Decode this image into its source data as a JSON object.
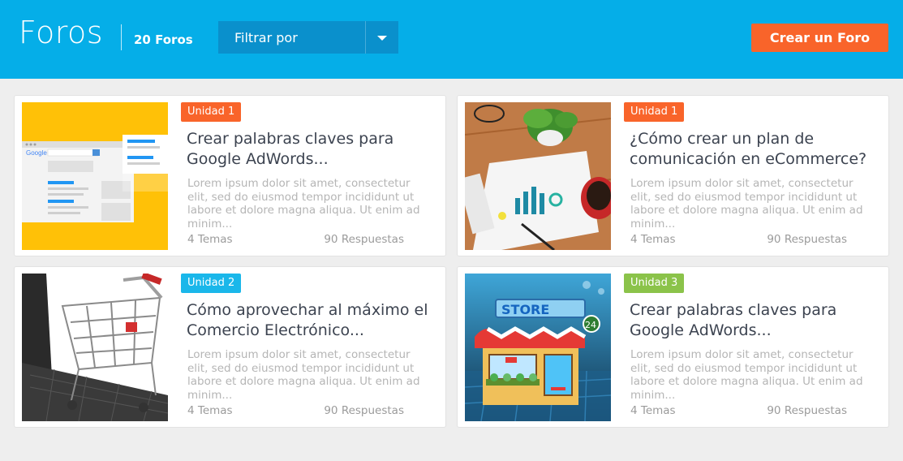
{
  "header": {
    "title": "Foros",
    "count_label": "20 Foros",
    "filter_label": "Filtrar por",
    "create_button": "Crear un Foro"
  },
  "colors": {
    "header_bg": "#05aee8",
    "filter_bg": "#0a90cc",
    "create_button": "#f9642a",
    "unit1": "#f9642a",
    "unit2": "#1ab7ea",
    "unit3": "#8bc34a"
  },
  "cards": [
    {
      "badge": "Unidad 1",
      "badge_color": "#f9642a",
      "title": "Crear palabras claves para Google AdWords...",
      "description": "Lorem ipsum dolor sit amet, consectetur elit, sed do eiusmod tempor incididunt ut labore et dolore magna aliqua. Ut enim ad minim...",
      "topics": "4 Temas",
      "replies": "90 Respuestas",
      "image_label": "Google"
    },
    {
      "badge": "Unidad 1",
      "badge_color": "#f9642a",
      "title": "¿Cómo crear un plan de comunicación en eCommerce?",
      "description": "Lorem ipsum dolor sit amet, consectetur elit, sed do eiusmod tempor incididunt ut labore et dolore magna aliqua. Ut enim ad minim...",
      "topics": "4 Temas",
      "replies": "90 Respuestas"
    },
    {
      "badge": "Unidad 2",
      "badge_color": "#1ab7ea",
      "title": "Cómo aprovechar al máximo el Comercio Electrónico...",
      "description": "Lorem ipsum dolor sit amet, consectetur elit, sed do eiusmod tempor incididunt ut labore et dolore magna aliqua. Ut enim ad minim...",
      "topics": "4 Temas",
      "replies": "90 Respuestas"
    },
    {
      "badge": "Unidad 3",
      "badge_color": "#8bc34a",
      "title": "Crear palabras claves para Google AdWords...",
      "description": "Lorem ipsum dolor sit amet, consectetur elit, sed do eiusmod tempor incididunt ut labore et dolore magna aliqua. Ut enim ad minim...",
      "topics": "4 Temas",
      "replies": "90 Respuestas",
      "image_label": "STORE",
      "image_sublabel": "24"
    }
  ]
}
